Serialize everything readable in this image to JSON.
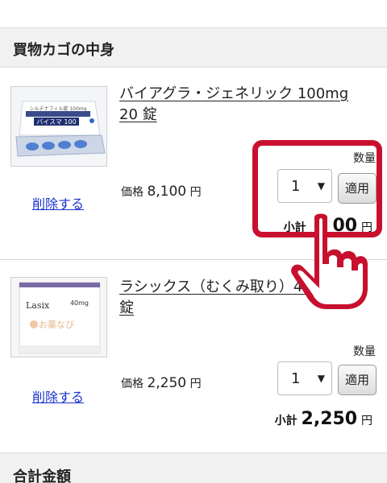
{
  "cart_title": "買物カゴの中身",
  "total_title": "合計金額",
  "items": [
    {
      "name": "バイアグラ・ジェネリック 100mg 20 錠",
      "delete_label": "削除する",
      "price_label": "価格",
      "price": "8,100",
      "yen": "円",
      "qty_label": "数量",
      "qty": "1",
      "apply_label": "適用",
      "subtotal_label": "小計",
      "subtotal_visible": "00",
      "subtotal_unit": "円",
      "thumb": {
        "box_text": "バイスマ 100",
        "small_text": "シルデナフィル錠 100mg"
      }
    },
    {
      "name": "ラシックス（むくみ取り）40mg 50 錠",
      "delete_label": "削除する",
      "price_label": "価格",
      "price": "2,250",
      "yen": "円",
      "qty_label": "数量",
      "qty": "1",
      "apply_label": "適用",
      "subtotal_label": "小計",
      "subtotal": "2,250",
      "subtotal_unit": "円",
      "thumb": {
        "brand": "Lasix",
        "dose": "40mg",
        "watermark": "お薬なび"
      }
    }
  ],
  "colors": {
    "highlight": "#c8102e",
    "link": "#1a33cc"
  }
}
